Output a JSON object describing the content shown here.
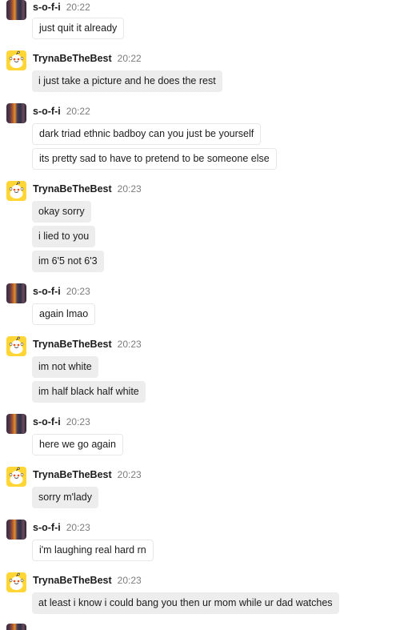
{
  "users": {
    "sofi": {
      "name": "s-o-f-i",
      "avatar_icon": "user-avatar-photo"
    },
    "tryna": {
      "name": "TrynaBeTheBest",
      "avatar_icon": "reddit-snoo-avatar-icon"
    }
  },
  "colors": {
    "snoo_avatar_bg": "#ffd635",
    "incoming_bubble_bg": "#ededed",
    "outgoing_bubble_border": "#e8e8e8",
    "timestamp": "#7c7c7c"
  },
  "messages": [
    {
      "user": "s-o-f-i",
      "time": "20:22",
      "lines": [
        "just quit it already"
      ]
    },
    {
      "user": "TrynaBeTheBest",
      "time": "20:22",
      "lines": [
        "i just take a picture and he does the rest"
      ]
    },
    {
      "user": "s-o-f-i",
      "time": "20:22",
      "lines": [
        "dark triad ethnic badboy can you just be yourself",
        "its pretty sad to have to pretend to be someone else"
      ]
    },
    {
      "user": "TrynaBeTheBest",
      "time": "20:23",
      "lines": [
        "okay sorry",
        "i lied to you",
        "im 6'5 not 6'3"
      ]
    },
    {
      "user": "s-o-f-i",
      "time": "20:23",
      "lines": [
        "again lmao"
      ]
    },
    {
      "user": "TrynaBeTheBest",
      "time": "20:23",
      "lines": [
        "im not white",
        "im half black half white"
      ]
    },
    {
      "user": "s-o-f-i",
      "time": "20:23",
      "lines": [
        "here we go again"
      ]
    },
    {
      "user": "TrynaBeTheBest",
      "time": "20:23",
      "lines": [
        "sorry m'lady"
      ]
    },
    {
      "user": "s-o-f-i",
      "time": "20:23",
      "lines": [
        "i'm laughing real hard rn"
      ]
    },
    {
      "user": "TrynaBeTheBest",
      "time": "20:23",
      "lines": [
        "at least i know i could bang you then ur mom while ur dad watches"
      ]
    }
  ]
}
